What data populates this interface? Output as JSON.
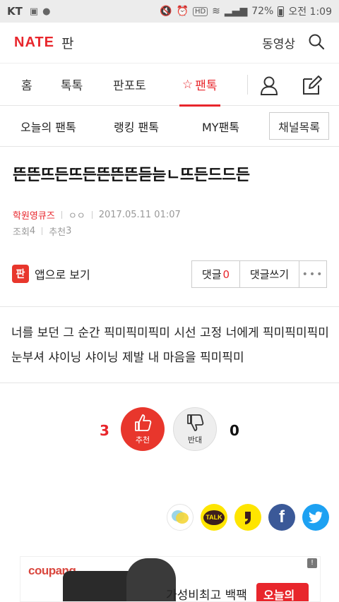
{
  "status_bar": {
    "carrier": "KT",
    "time": "오전 1:09",
    "battery": "72%"
  },
  "header": {
    "logo": "NATE",
    "section": "판",
    "video_link": "동영상"
  },
  "main_nav": {
    "items": [
      "홈",
      "톡톡",
      "판포토",
      "팬톡"
    ],
    "active": "팬톡"
  },
  "sub_nav": {
    "items": [
      "오늘의 팬톡",
      "랭킹 팬톡",
      "MY팬톡"
    ],
    "channel_button": "채널목록"
  },
  "post": {
    "title": "뜬뜬뜨든뜨든뜬뜬뜬듣늗ㄴ뜨든드드든",
    "author": "학원영큐즈",
    "author_extra": "ㅇㅇ",
    "date": "2017.05.11 01:07",
    "views_label": "조회",
    "views": "4",
    "recommend_label": "추천",
    "recommend": "3",
    "body": "너를 보던 그 순간 픽미픽미픽미 시선 고정 너에게 픽미픽미픽미 눈부셔 샤이닝 샤이닝 제발 내 마음을 픽미픽미"
  },
  "actions": {
    "app_icon_text": "판",
    "app_view": "앱으로 보기",
    "comment_label": "댓글",
    "comment_count": "0",
    "write_comment": "댓글쓰기",
    "more": "•••"
  },
  "votes": {
    "up_count": "3",
    "up_label": "추천",
    "down_count": "0",
    "down_label": "반대"
  },
  "share": {
    "buttons": [
      "kakaostory-icon",
      "kakaotalk-icon",
      "kakaopage-icon",
      "facebook-icon",
      "twitter-icon"
    ],
    "talk_text": "TALK"
  },
  "ad": {
    "brand": "coupang",
    "text": "가성비최고 백팩",
    "cta": "오늘의"
  },
  "colors": {
    "accent": "#e8262c",
    "facebook": "#3b5998",
    "twitter": "#1da1f2",
    "kakao": "#fee500"
  }
}
